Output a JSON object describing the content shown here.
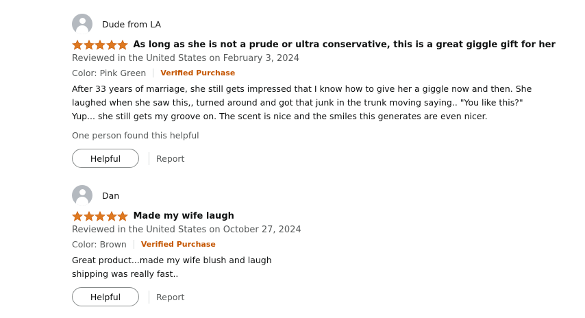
{
  "reviews": [
    {
      "reviewer": "Dude from LA",
      "rating": 5,
      "title": "As long as she is not a prude or ultra conservative, this is a great giggle gift for her",
      "date": "Reviewed in the United States on February 3, 2024",
      "variant": "Color: Pink Green",
      "verified": "Verified Purchase",
      "body": [
        "After 33 years of marriage, she still gets impressed that I know how to give her a giggle now and then. She",
        "laughed when she saw this,, turned around and got that junk in the trunk moving saying.. \"You like this?\"",
        "Yup... she still gets my groove on. The scent is nice and the smiles this generates are even nicer."
      ],
      "helpful_count": "One person found this helpful",
      "helpful_label": "Helpful",
      "report_label": "Report"
    },
    {
      "reviewer": "Dan",
      "rating": 5,
      "title": "Made my wife laugh",
      "date": "Reviewed in the United States on October 27, 2024",
      "variant": "Color: Brown",
      "verified": "Verified Purchase",
      "body": [
        "Great product...made my wife blush and laugh",
        "shipping was really fast.."
      ],
      "helpful_label": "Helpful",
      "report_label": "Report"
    }
  ],
  "colors": {
    "star": "#de7921",
    "verified": "#c45500",
    "muted_text": "#565959",
    "avatar": "#b4b9bf"
  }
}
